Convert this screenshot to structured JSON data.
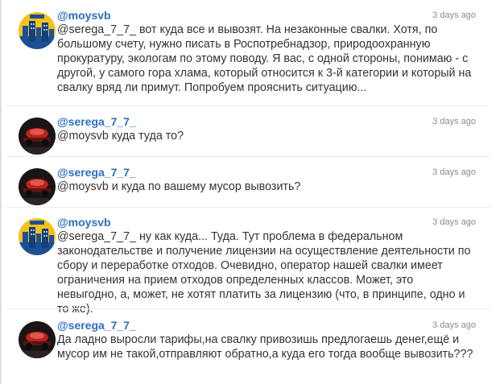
{
  "colors": {
    "author": "#2b6fc2",
    "text": "#333333",
    "timestamp": "#8a8a8a"
  },
  "comments": [
    {
      "author": "@moysvb",
      "time": "3 days ago",
      "avatar_icon": "city-skyline-avatar-icon",
      "text": "@serega_7_7_ вот куда все и вывозят. На незаконные свалки. Хотя, по большому счету, нужно писать в Роспотребнадзор, природоохранную прокуратуру, экологам по этому поводу. Я вас, с одной стороны, понимаю - с другой, у самого гора хлама, который относится к 3-й категории и который на свалку вряд ли примут. Попробуем прояснить ситуацию..."
    },
    {
      "author": "@serega_7_7_",
      "time": "3 days ago",
      "avatar_icon": "car-photo-avatar-icon",
      "text": "@moysvb куда туда то?"
    },
    {
      "author": "@serega_7_7_",
      "time": "3 days ago",
      "avatar_icon": "car-photo-avatar-icon",
      "text": "@moysvb и куда по вашему мусор вывозить?"
    },
    {
      "author": "@moysvb",
      "time": "3 days ago",
      "avatar_icon": "city-skyline-avatar-icon",
      "text": "@serega_7_7_ ну как куда... Туда. Тут проблема в федеральном законодательстве и получение лицензии на осуществление деятельности по сбору и переработке отходов. Очевидно, оператор нашей свалки имеет ограничения на прием отходов определенных классов. Может, это невыгодно, а, может, не хотят платить за лицензию (что, в принципе, одно и то же)."
    },
    {
      "author": "@serega_7_7_",
      "time": "3 days ago",
      "avatar_icon": "car-photo-avatar-icon",
      "text": "Да ладно выросли тарифы,на свалку привозишь предлогаешь денег,ещё и мусор им не такой,отправляют обратно,а куда его тогда вообще вывозить???"
    }
  ]
}
